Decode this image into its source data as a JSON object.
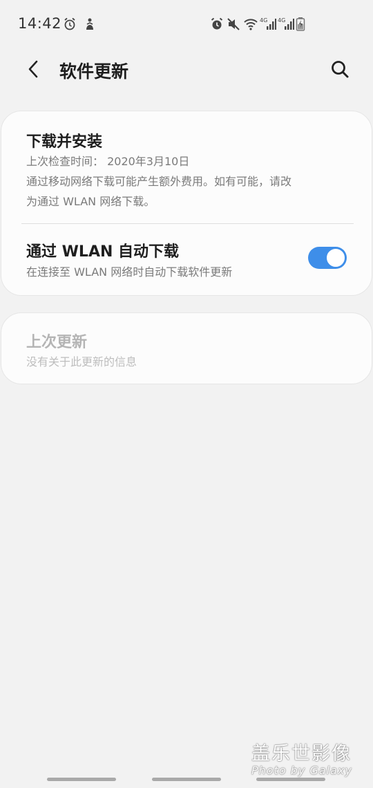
{
  "status_bar": {
    "time": "14:42",
    "icons_left": [
      "alarm-icon",
      "accessibility-icon"
    ],
    "icons_right": [
      "alarm-icon",
      "mute-icon",
      "wifi-icon",
      "signal-4g-icon",
      "signal-4g-icon",
      "battery-charging-icon"
    ],
    "network_label_1": "4G",
    "network_label_2": "4G"
  },
  "app_bar": {
    "title": "软件更新",
    "back_icon": "chevron-left-icon",
    "search_icon": "search-icon"
  },
  "download_card": {
    "title": "下载并安装",
    "last_check": "上次检查时间： 2020年3月10日",
    "note_line1": "通过移动网络下载可能产生额外费用。如有可能，请改",
    "note_line2": "为通过 WLAN 网络下载。",
    "wlan_title": "通过 WLAN 自动下载",
    "wlan_sub": "在连接至 WLAN 网络时自动下载软件更新",
    "wlan_toggle_on": true
  },
  "last_update_card": {
    "title": "上次更新",
    "sub": "没有关于此更新的信息"
  },
  "watermark": {
    "cn": "盖乐世影像",
    "en": "Photo by Galaxy"
  },
  "colors": {
    "accent": "#3e8ee9",
    "background": "#f2f2f2",
    "card": "#fcfcfc"
  }
}
